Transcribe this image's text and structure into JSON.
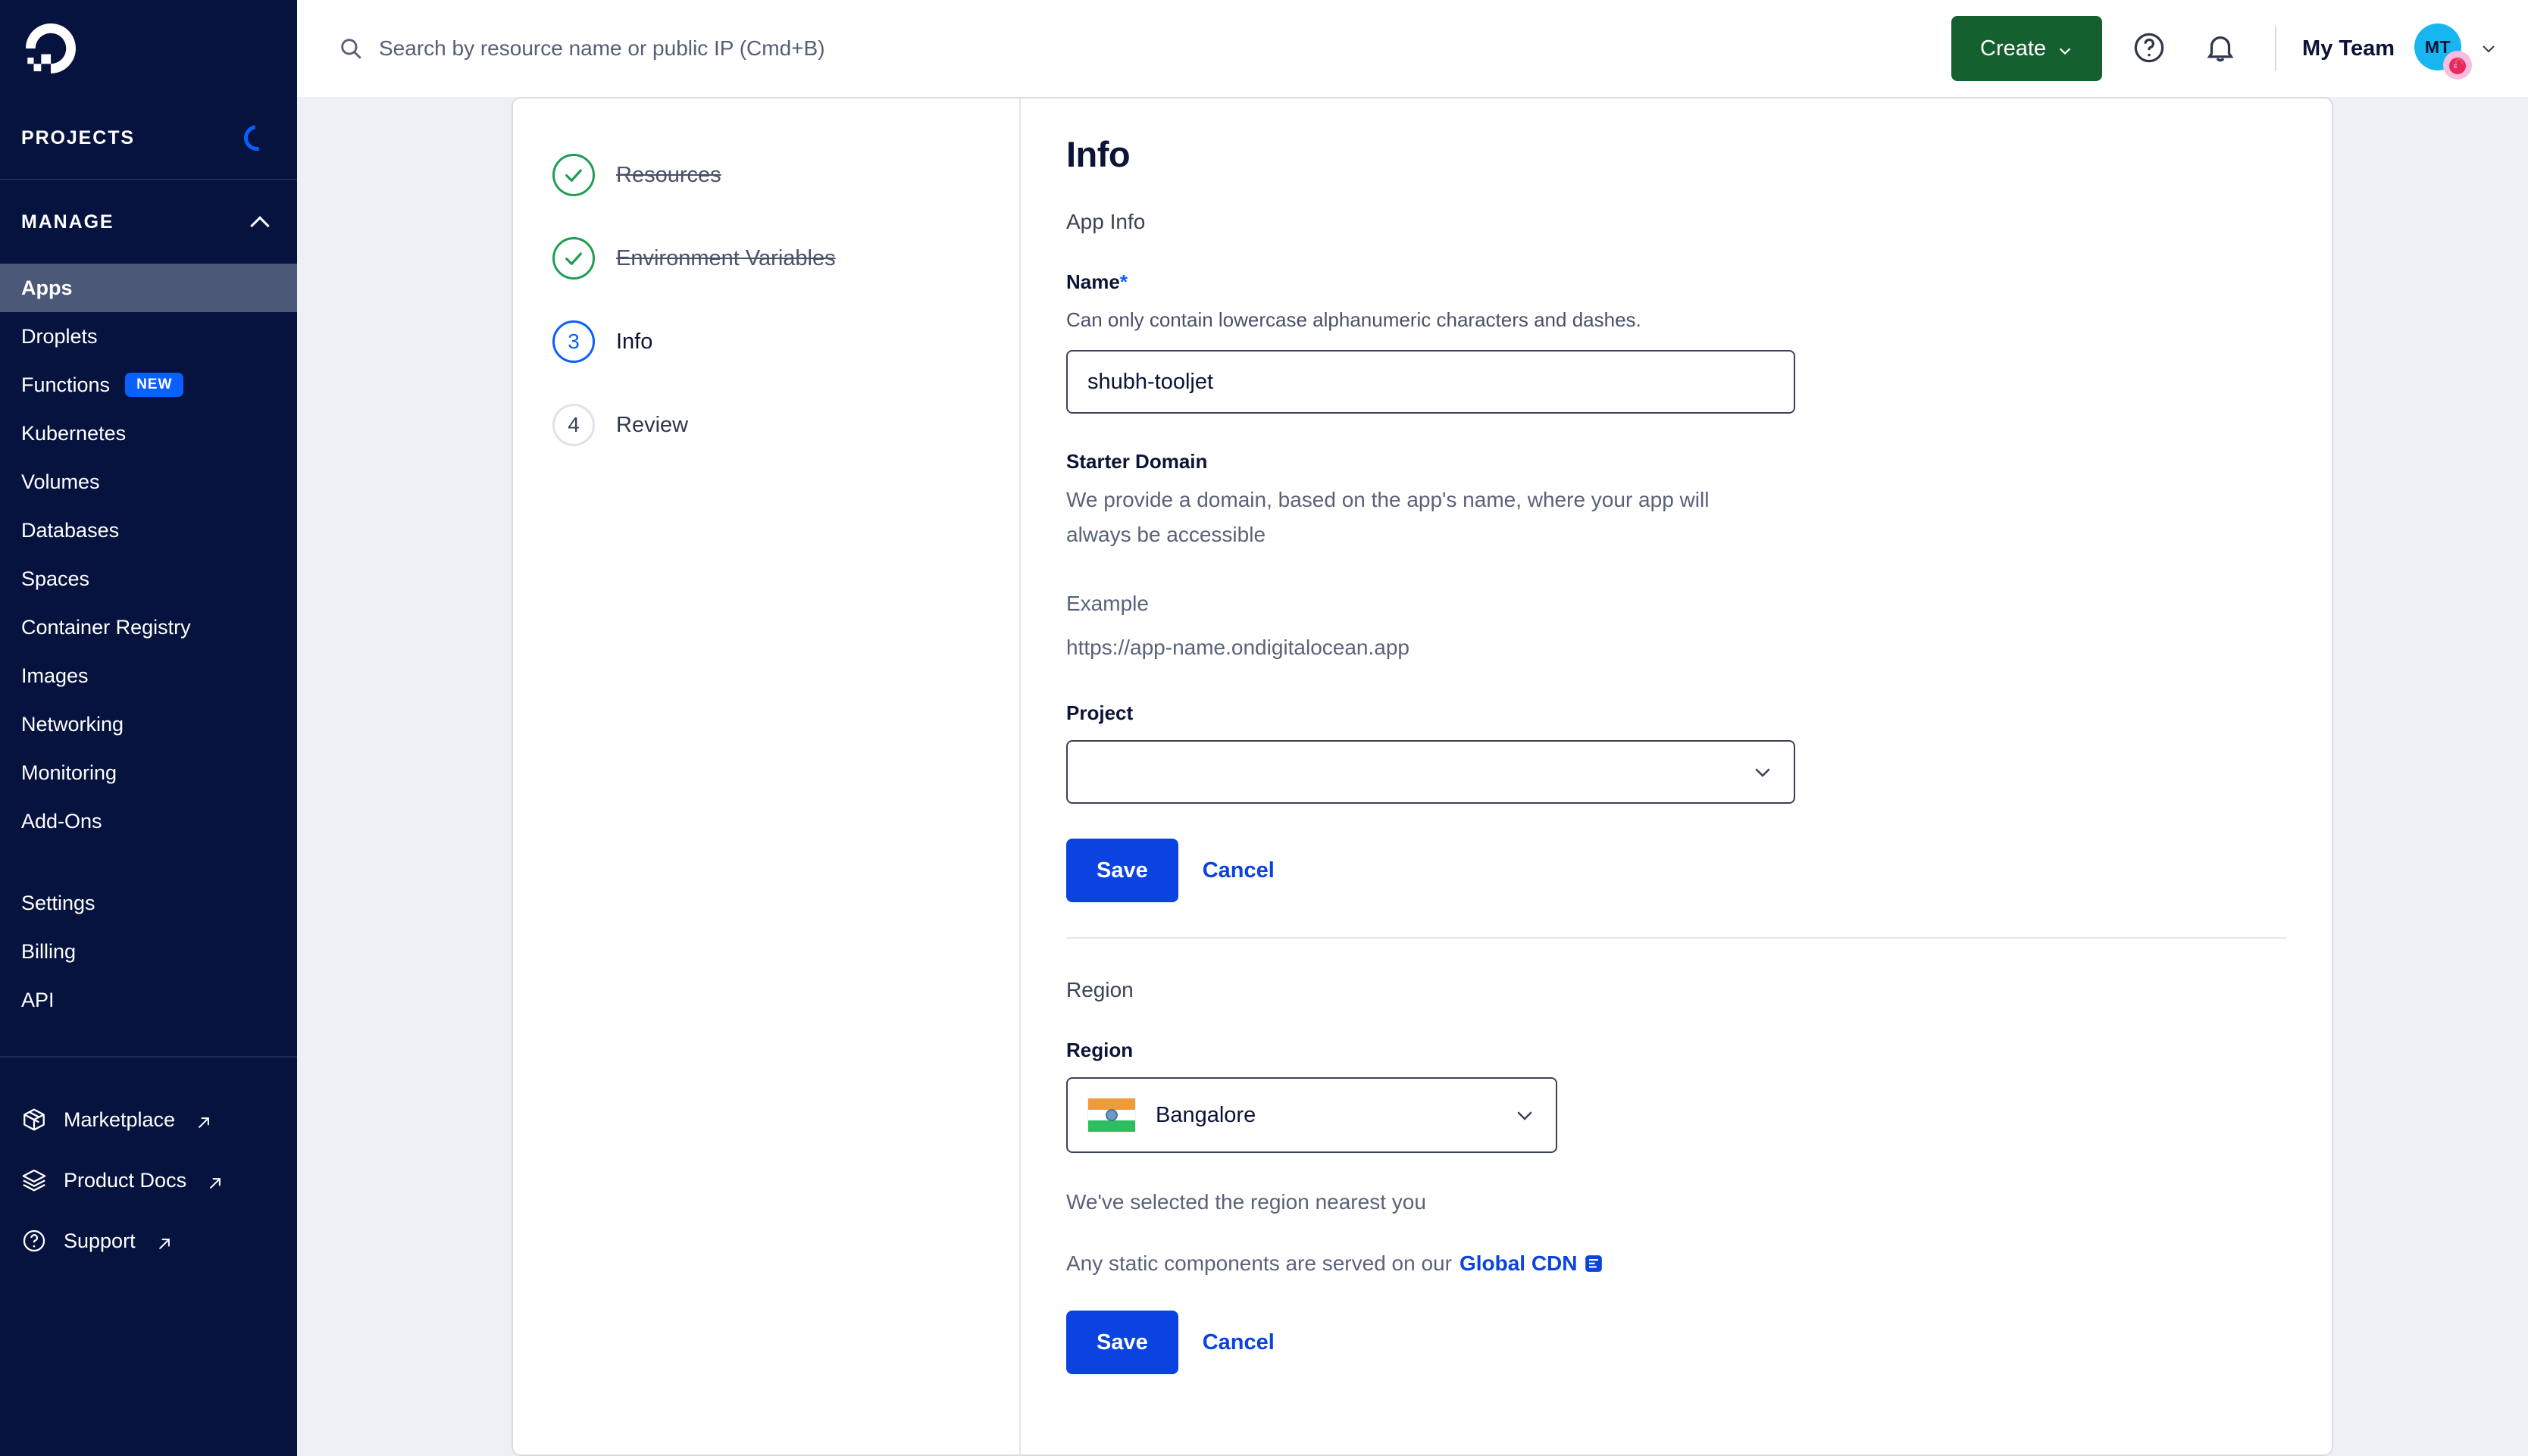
{
  "brand": {
    "logo_icon": "digitalocean-logo",
    "accent_blue": "#0b43e0",
    "sidebar_bg": "#06133f",
    "create_green": "#14602f",
    "active_item_bg": "#4c5878"
  },
  "sidebar": {
    "projects_label": "PROJECTS",
    "projects_spinner_icon": "loading-spinner-icon",
    "manage_label": "MANAGE",
    "manage_collapse_icon": "chevron-up-icon",
    "items": [
      {
        "label": "Apps",
        "active": true,
        "badge": null
      },
      {
        "label": "Droplets",
        "active": false,
        "badge": null
      },
      {
        "label": "Functions",
        "active": false,
        "badge": "NEW"
      },
      {
        "label": "Kubernetes",
        "active": false,
        "badge": null
      },
      {
        "label": "Volumes",
        "active": false,
        "badge": null
      },
      {
        "label": "Databases",
        "active": false,
        "badge": null
      },
      {
        "label": "Spaces",
        "active": false,
        "badge": null
      },
      {
        "label": "Container Registry",
        "active": false,
        "badge": null
      },
      {
        "label": "Images",
        "active": false,
        "badge": null
      },
      {
        "label": "Networking",
        "active": false,
        "badge": null
      },
      {
        "label": "Monitoring",
        "active": false,
        "badge": null
      },
      {
        "label": "Add-Ons",
        "active": false,
        "badge": null
      }
    ],
    "account_items": [
      {
        "label": "Settings"
      },
      {
        "label": "Billing"
      },
      {
        "label": "API"
      }
    ],
    "external_items": [
      {
        "label": "Marketplace",
        "icon": "cube-icon"
      },
      {
        "label": "Product Docs",
        "icon": "layers-icon"
      },
      {
        "label": "Support",
        "icon": "question-circle-icon"
      }
    ],
    "external_arrow_icon": "external-link-arrow-icon"
  },
  "topbar": {
    "search_placeholder": "Search by resource name or public IP (Cmd+B)",
    "search_value": "",
    "search_icon": "search-icon",
    "create_label": "Create",
    "create_chevron_icon": "chevron-down-icon",
    "help_icon": "question-circle-icon",
    "notifications_icon": "bell-icon",
    "team_name": "My Team",
    "avatar_initials": "MT",
    "avatar_chevron_icon": "chevron-down-icon"
  },
  "wizard": {
    "steps": [
      {
        "number": "1",
        "label": "Resources",
        "state": "done",
        "icon": "check-icon"
      },
      {
        "number": "2",
        "label": "Environment Variables",
        "state": "done",
        "icon": "check-icon"
      },
      {
        "number": "3",
        "label": "Info",
        "state": "current",
        "icon": null
      },
      {
        "number": "4",
        "label": "Review",
        "state": "todo",
        "icon": null
      }
    ]
  },
  "form": {
    "title": "Info",
    "app_info_heading": "App Info",
    "name_label": "Name",
    "name_required_marker": "*",
    "name_helper": "Can only contain lowercase alphanumeric characters and dashes.",
    "name_value": "shubh-tooljet",
    "starter_domain_label": "Starter Domain",
    "starter_domain_description": "We provide a domain, based on the app's name, where your app will always be accessible",
    "example_label": "Example",
    "example_url": "https://app-name.ondigitalocean.app",
    "project_label": "Project",
    "project_value": "",
    "project_chevron_icon": "chevron-down-icon",
    "save_label": "Save",
    "cancel_label": "Cancel",
    "region_section_heading": "Region",
    "region_label": "Region",
    "region_value": "Bangalore",
    "region_flag_icon": "india-flag-icon",
    "region_chevron_icon": "chevron-down-icon",
    "region_note": "We've selected the region nearest you",
    "cdn_note_prefix": "Any static components are served on our",
    "cdn_link_label": "Global CDN",
    "cdn_doc_icon": "document-icon",
    "save_label_region": "Save",
    "cancel_label_region": "Cancel"
  }
}
